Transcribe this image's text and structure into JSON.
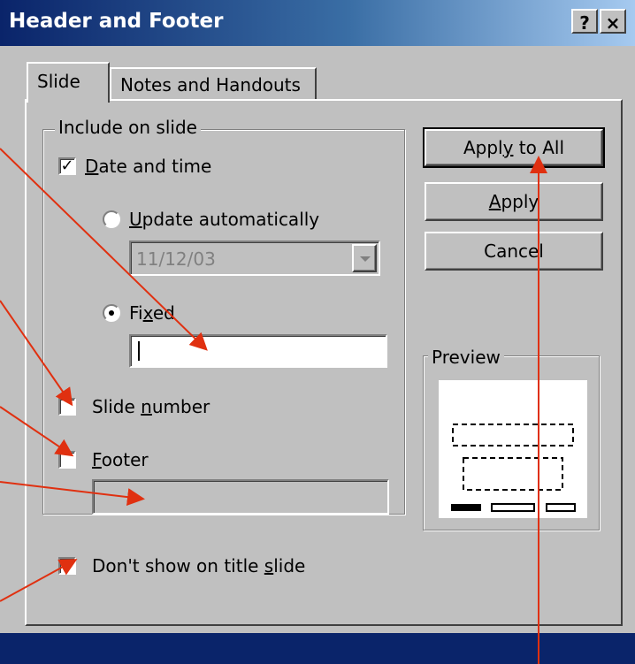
{
  "window": {
    "title": "Header and Footer",
    "help_button": "?",
    "close_button": "×"
  },
  "tabs": [
    {
      "label": "Slide",
      "active": true
    },
    {
      "label": "Notes and Handouts",
      "active": false
    }
  ],
  "include_group": {
    "legend": "Include on slide",
    "date_time": {
      "label_pre": "",
      "label_u": "D",
      "label_post": "ate and time",
      "checked": true
    },
    "update_auto": {
      "label_pre": "",
      "label_u": "U",
      "label_post": "pdate automatically",
      "selected": false
    },
    "date_dropdown": {
      "value": "11/12/03"
    },
    "fixed": {
      "label_pre": "Fi",
      "label_u": "x",
      "label_post": "ed",
      "selected": true
    },
    "fixed_input": {
      "value": ""
    },
    "slide_number": {
      "label_pre": "Slide ",
      "label_u": "n",
      "label_post": "umber",
      "checked": false
    },
    "footer": {
      "label_pre": "",
      "label_u": "F",
      "label_post": "ooter",
      "checked": false
    },
    "footer_input": {
      "value": ""
    }
  },
  "dont_show": {
    "label_pre": "Don't show on title ",
    "label_u": "s",
    "label_post": "lide",
    "checked": false
  },
  "buttons": {
    "apply_all": {
      "pre": "Appl",
      "u": "y",
      "post": " to All"
    },
    "apply": {
      "pre": "",
      "u": "A",
      "post": "pply"
    },
    "cancel": {
      "label": "Cancel"
    }
  },
  "preview": {
    "legend": "Preview"
  },
  "colors": {
    "annotation_arrow": "#e03010",
    "titlebar": "#0a246a"
  }
}
